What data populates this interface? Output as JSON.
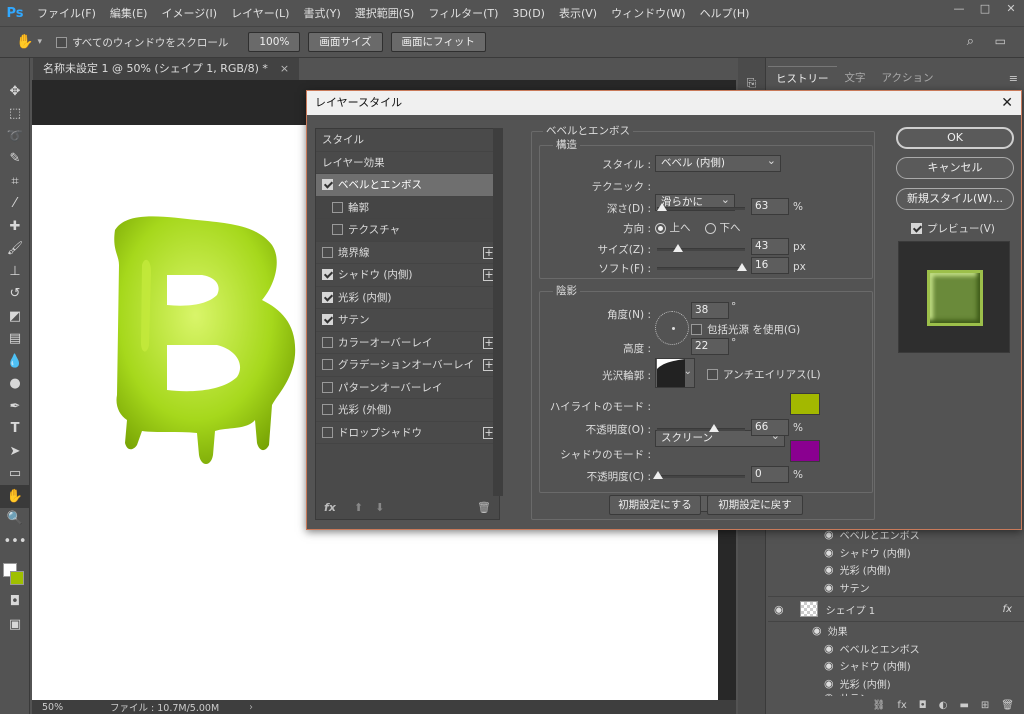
{
  "app": {
    "logo": "Ps"
  },
  "menu": [
    "ファイル(F)",
    "編集(E)",
    "イメージ(I)",
    "レイヤー(L)",
    "書式(Y)",
    "選択範囲(S)",
    "フィルター(T)",
    "3D(D)",
    "表示(V)",
    "ウィンドウ(W)",
    "ヘルプ(H)"
  ],
  "options": {
    "scroll_all_label": "すべてのウィンドウをスクロール",
    "btn_100": "100%",
    "btn_fit_screen": "画面サイズ",
    "btn_fill_screen": "画面にフィット"
  },
  "document": {
    "tab_title": "名称未設定 1 @ 50% (シェイプ 1, RGB/8) *",
    "zoom": "50%",
    "file_info": "ファイル : 10.7M/5.00M"
  },
  "right_tabs": [
    "ヒストリー",
    "文字",
    "アクション"
  ],
  "layers": {
    "effects_top": [
      "ベベルとエンボス",
      "シャドウ (内側)",
      "光彩 (内側)",
      "サテン"
    ],
    "shape_layer_name": "シェイプ 1",
    "effects_label": "効果",
    "effects_bottom": [
      "ベベルとエンボス",
      "シャドウ (内側)",
      "光彩 (内側)",
      "サテン"
    ]
  },
  "dialog": {
    "title": "レイヤースタイル",
    "style_list": {
      "styles_label": "スタイル",
      "layer_effects_label": "レイヤー効果",
      "items": [
        {
          "label": "ベベルとエンボス",
          "checked": true,
          "selected": true,
          "sub": false,
          "plus": false
        },
        {
          "label": "輪郭",
          "checked": false,
          "selected": false,
          "sub": true,
          "plus": false
        },
        {
          "label": "テクスチャ",
          "checked": false,
          "selected": false,
          "sub": true,
          "plus": false
        },
        {
          "label": "境界線",
          "checked": false,
          "selected": false,
          "sub": false,
          "plus": true
        },
        {
          "label": "シャドウ (内側)",
          "checked": true,
          "selected": false,
          "sub": false,
          "plus": true
        },
        {
          "label": "光彩 (内側)",
          "checked": true,
          "selected": false,
          "sub": false,
          "plus": false
        },
        {
          "label": "サテン",
          "checked": true,
          "selected": false,
          "sub": false,
          "plus": false
        },
        {
          "label": "カラーオーバーレイ",
          "checked": false,
          "selected": false,
          "sub": false,
          "plus": true
        },
        {
          "label": "グラデーションオーバーレイ",
          "checked": false,
          "selected": false,
          "sub": false,
          "plus": true
        },
        {
          "label": "パターンオーバーレイ",
          "checked": false,
          "selected": false,
          "sub": false,
          "plus": false
        },
        {
          "label": "光彩 (外側)",
          "checked": false,
          "selected": false,
          "sub": false,
          "plus": false
        },
        {
          "label": "ドロップシャドウ",
          "checked": false,
          "selected": false,
          "sub": false,
          "plus": true
        }
      ]
    },
    "bevel": {
      "group_title": "ベベルとエンボス",
      "structure_title": "構造",
      "style_label": "スタイル :",
      "style_value": "ベベル (内側)",
      "technique_label": "テクニック :",
      "technique_value": "滑らかに",
      "depth_label": "深さ(D) :",
      "depth_value": "63",
      "depth_unit": "%",
      "direction_label": "方向 :",
      "dir_up": "上へ",
      "dir_down": "下へ",
      "size_label": "サイズ(Z) :",
      "size_value": "43",
      "size_unit": "px",
      "soften_label": "ソフト(F) :",
      "soften_value": "16",
      "soften_unit": "px"
    },
    "shading": {
      "title": "陰影",
      "angle_label": "角度(N) :",
      "angle_value": "38",
      "angle_unit": "°",
      "global_light_label": "包括光源 を使用(G)",
      "altitude_label": "高度 :",
      "altitude_value": "22",
      "altitude_unit": "°",
      "gloss_label": "光沢輪郭 :",
      "antialias_label": "アンチエイリアス(L)",
      "highlight_mode_label": "ハイライトのモード :",
      "highlight_mode_value": "スクリーン",
      "highlight_color": "#a3b800",
      "highlight_opacity_label": "不透明度(O) :",
      "highlight_opacity_value": "66",
      "highlight_opacity_unit": "%",
      "shadow_mode_label": "シャドウのモード :",
      "shadow_mode_value": "乗算",
      "shadow_color": "#8a0090",
      "shadow_opacity_label": "不透明度(C) :",
      "shadow_opacity_value": "0",
      "shadow_opacity_unit": "%"
    },
    "make_default": "初期設定にする",
    "reset_default": "初期設定に戻す",
    "buttons": {
      "ok": "OK",
      "cancel": "キャンセル",
      "new_style": "新規スタイル(W)...",
      "preview": "プレビュー(V)"
    }
  },
  "colors": {
    "accent_green": "#9acd1a",
    "foreground_swatch": "#ffffff",
    "background_swatch": "#9fbf00"
  }
}
